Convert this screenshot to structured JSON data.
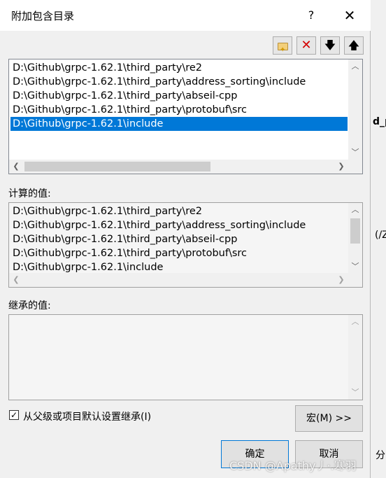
{
  "window": {
    "title": "附加包含目录",
    "help": "?",
    "close": "✕"
  },
  "toolbar": {
    "new_line": "new-line",
    "delete": "✕",
    "move_down": "🡇",
    "move_up": "🡅"
  },
  "include_list": {
    "items": [
      "D:\\Github\\grpc-1.62.1\\third_party\\re2",
      "D:\\Github\\grpc-1.62.1\\third_party\\address_sorting\\include",
      "D:\\Github\\grpc-1.62.1\\third_party\\abseil-cpp",
      "D:\\Github\\grpc-1.62.1\\third_party\\protobuf\\src",
      "D:\\Github\\grpc-1.62.1\\include"
    ],
    "selected_index": 4
  },
  "evaluated": {
    "label": "计算的值:",
    "items": [
      "D:\\Github\\grpc-1.62.1\\third_party\\re2",
      "D:\\Github\\grpc-1.62.1\\third_party\\address_sorting\\include",
      "D:\\Github\\grpc-1.62.1\\third_party\\abseil-cpp",
      "D:\\Github\\grpc-1.62.1\\third_party\\protobuf\\src",
      "D:\\Github\\grpc-1.62.1\\include"
    ]
  },
  "inherited": {
    "label": "继承的值:",
    "items": []
  },
  "inherit_checkbox": {
    "label": "从父级或项目默认设置继承(I)",
    "checked": true
  },
  "buttons": {
    "macros": "宏(M) >>",
    "ok": "确定",
    "cancel": "取消"
  },
  "background": {
    "fragment_1": "d_p",
    "fragment_2": "(/Z",
    "fragment_3": "分"
  },
  "watermark": "CSDN @Apathy丿·.寒羽"
}
